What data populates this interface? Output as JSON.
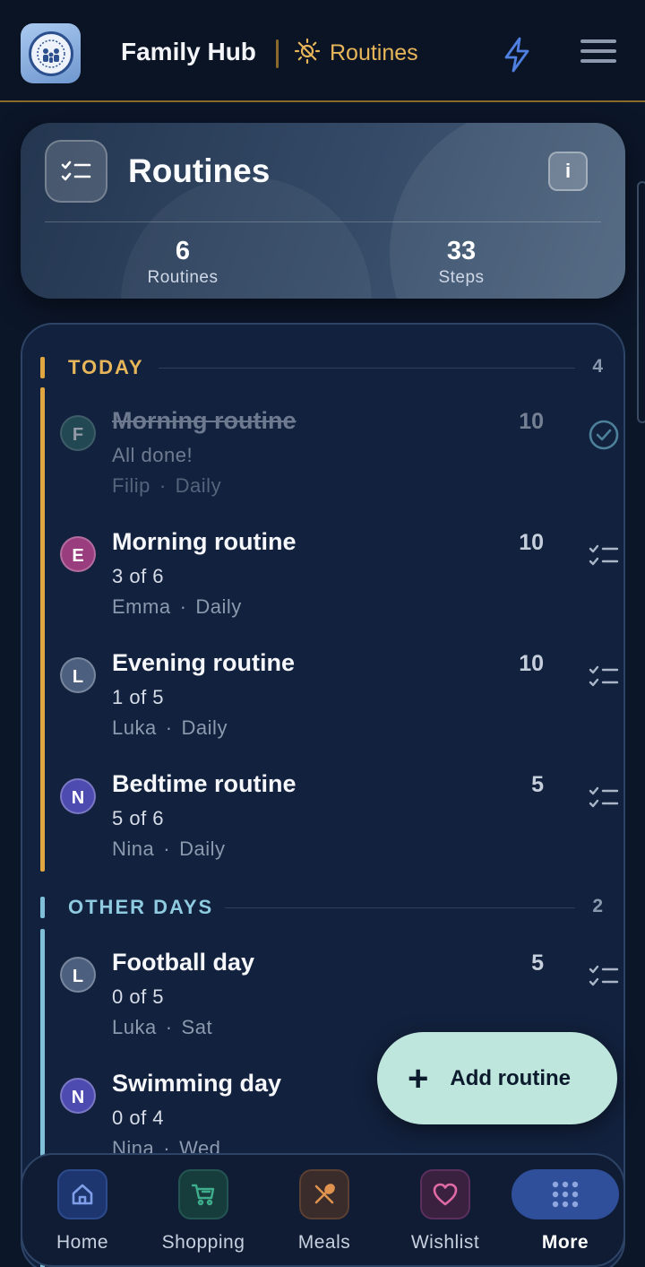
{
  "header": {
    "app_title": "Family Hub",
    "section_label": "Routines",
    "accent_color": "#e8b65a",
    "icons": [
      "family-logo",
      "sun-icon",
      "bolt-icon",
      "menu-icon"
    ]
  },
  "summary": {
    "title": "Routines",
    "info_label": "i",
    "stats": [
      {
        "value": "6",
        "label": "Routines"
      },
      {
        "value": "33",
        "label": "Steps"
      }
    ]
  },
  "groups": [
    {
      "title": "TODAY",
      "count": "4",
      "color": "#e0a63f",
      "items": [
        {
          "initial": "F",
          "name": "Morning routine",
          "progress": "All done!",
          "person": "Filip",
          "sep": "·",
          "schedule": "Daily",
          "points": "10",
          "done": true,
          "avatar_color": "#2f6b66"
        },
        {
          "initial": "E",
          "name": "Morning routine",
          "progress": "3 of 6",
          "person": "Emma",
          "sep": "·",
          "schedule": "Daily",
          "points": "10",
          "done": false,
          "avatar_color": "#9a3d7f"
        },
        {
          "initial": "L",
          "name": "Evening routine",
          "progress": "1 of 5",
          "person": "Luka",
          "sep": "·",
          "schedule": "Daily",
          "points": "10",
          "done": false,
          "avatar_color": "#4d5f7e"
        },
        {
          "initial": "N",
          "name": "Bedtime routine",
          "progress": "5 of 6",
          "person": "Nina",
          "sep": "·",
          "schedule": "Daily",
          "points": "5",
          "done": false,
          "avatar_color": "#4e4bb0"
        }
      ]
    },
    {
      "title": "OTHER DAYS",
      "count": "2",
      "color": "#7fc0d8",
      "items": [
        {
          "initial": "L",
          "name": "Football day",
          "progress": "0 of 5",
          "person": "Luka",
          "sep": "·",
          "schedule": "Sat",
          "points": "5",
          "done": false,
          "avatar_color": "#4d5f7e"
        },
        {
          "initial": "N",
          "name": "Swimming day",
          "progress": "0 of 4",
          "person": "Nina",
          "sep": "·",
          "schedule": "Wed",
          "points": "",
          "done": false,
          "avatar_color": "#4e4bb0"
        }
      ]
    }
  ],
  "fab": {
    "plus": "+",
    "label": "Add routine"
  },
  "nav": [
    {
      "label": "Home",
      "icon": "home-icon",
      "color": "#6f8fe0",
      "active": false
    },
    {
      "label": "Shopping",
      "icon": "cart-icon",
      "color": "#3fae8c",
      "active": false
    },
    {
      "label": "Meals",
      "icon": "utensils-icon",
      "color": "#e0924f",
      "active": false
    },
    {
      "label": "Wishlist",
      "icon": "heart-icon",
      "color": "#e06aa4",
      "active": false
    },
    {
      "label": "More",
      "icon": "grid-icon",
      "color": "#8fa6df",
      "active": true
    }
  ]
}
